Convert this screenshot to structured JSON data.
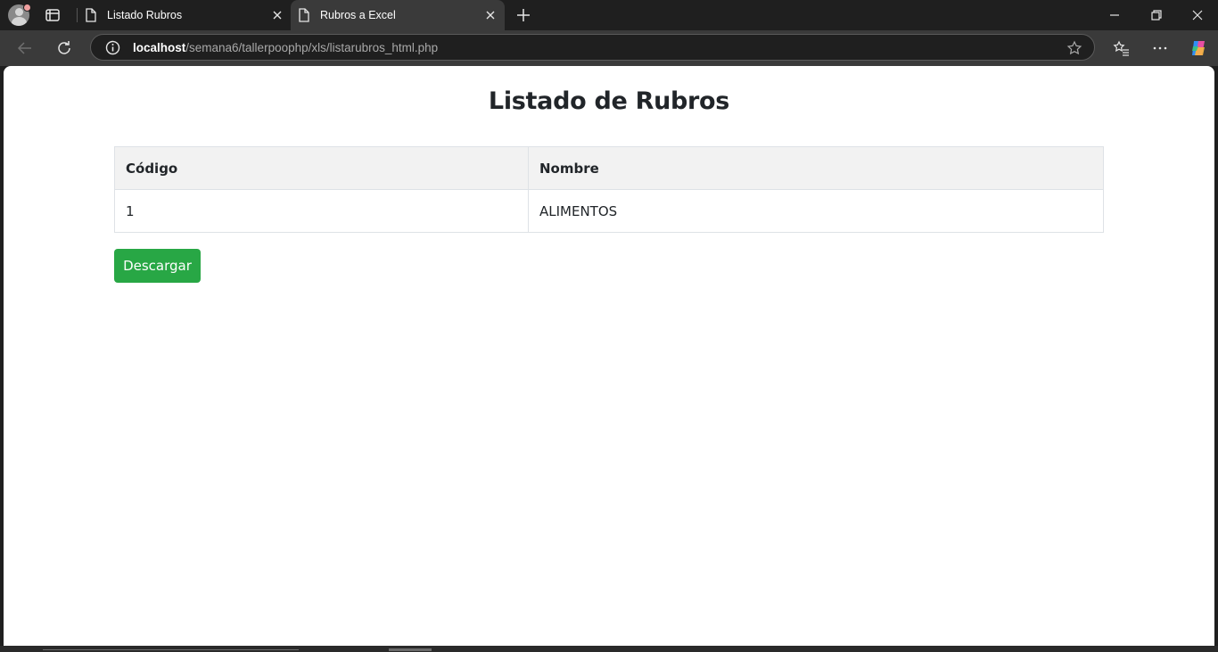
{
  "browser": {
    "tabs": [
      {
        "title": "Listado Rubros",
        "active": false
      },
      {
        "title": "Rubros a Excel",
        "active": true
      }
    ],
    "address": {
      "host": "localhost",
      "path": "/semana6/tallerpoophp/xls/listarubros_html.php"
    }
  },
  "page": {
    "title": "Listado de Rubros",
    "table": {
      "headers": [
        "Código",
        "Nombre"
      ],
      "rows": [
        [
          "1",
          "ALIMENTOS"
        ]
      ]
    },
    "download_label": "Descargar"
  },
  "colors": {
    "button_green": "#28a745",
    "header_bg": "#f2f2f2",
    "browser_dark": "#1f1f1f",
    "toolbar": "#3a3a3a"
  }
}
